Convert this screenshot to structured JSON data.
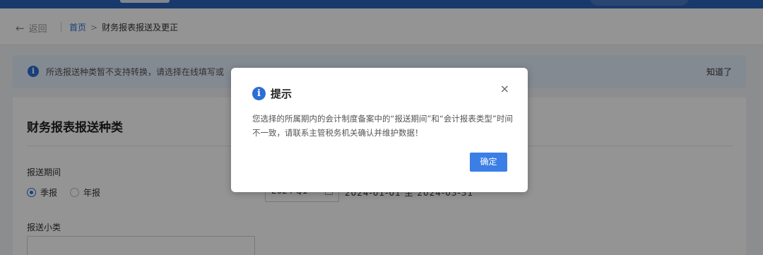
{
  "header": {},
  "breadcrumb": {
    "back_label": "返回",
    "back_icon": "arrow-left-icon",
    "home": "首页",
    "separator": ">",
    "current": "财务报表报送及更正"
  },
  "notice": {
    "icon": "info-icon",
    "text": "所选报送种类暂不支持转换，请选择在线填写或",
    "ack_label": "知道了"
  },
  "card": {
    "title": "财务报表报送种类",
    "period_label": "报送期间",
    "period_options": [
      {
        "label": "季报",
        "selected": true
      },
      {
        "label": "年报",
        "selected": false
      }
    ],
    "date_select_value": "2024 Q1",
    "date_range": "2024-01-01 至 2024-03-31",
    "subcategory_label": "报送小类"
  },
  "dialog": {
    "icon": "info-icon",
    "title": "提示",
    "close_glyph": "×",
    "body": "您选择的所属期内的会计制度备案中的“报送期间”和“会计报表类型”时间不一致，请联系主管税务机关确认并维护数据！",
    "ok_label": "确定"
  },
  "colors": {
    "accent": "#2c6ed5",
    "button": "#3b7ee6",
    "topbar": "#2a62b8",
    "notice_bg": "#e3eefc"
  }
}
